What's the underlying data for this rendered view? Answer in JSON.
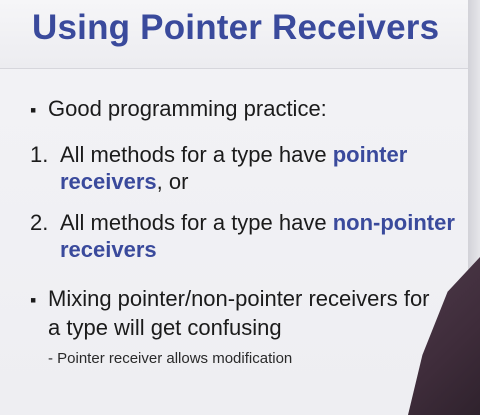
{
  "slide": {
    "title": "Using Pointer Receivers",
    "intro": "Good programming practice:",
    "item1": {
      "number": "1.",
      "text": "All methods for a type have",
      "highlight": "pointer receivers",
      "suffix": ", or"
    },
    "item2": {
      "number": "2.",
      "text": "All methods for a type have",
      "highlight": "non-pointer receivers"
    },
    "bullet2": {
      "line1": "Mixing pointer/non-pointer receivers for",
      "line2": "a type will get confusing"
    },
    "sub_bullet": "- Pointer receiver allows modification"
  },
  "colors": {
    "accent": "#3a4a9c",
    "text": "#1b1b1b",
    "background": "#eeeef2"
  }
}
